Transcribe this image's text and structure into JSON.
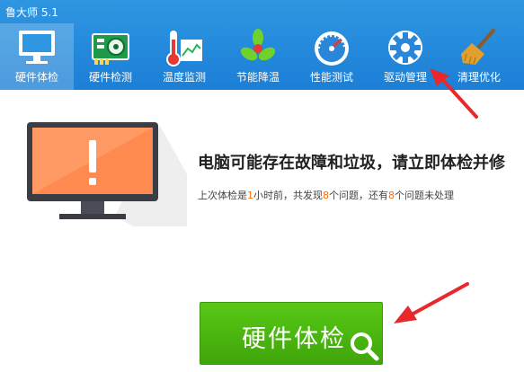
{
  "app": {
    "title": "鲁大师 5.1"
  },
  "nav": {
    "items": [
      {
        "label": "硬件体检",
        "icon": "monitor-icon",
        "active": true
      },
      {
        "label": "硬件检测",
        "icon": "graphics-card-icon",
        "active": false
      },
      {
        "label": "温度监测",
        "icon": "thermometer-icon",
        "active": false
      },
      {
        "label": "节能降温",
        "icon": "fan-icon",
        "active": false
      },
      {
        "label": "性能测试",
        "icon": "speedometer-icon",
        "active": false
      },
      {
        "label": "驱动管理",
        "icon": "gear-icon",
        "active": false
      },
      {
        "label": "清理优化",
        "icon": "broom-icon",
        "active": false
      }
    ]
  },
  "main": {
    "headline": "电脑可能存在故障和垃圾，请立即体检并修",
    "status": {
      "part1": "上次体检是",
      "hours": "1",
      "part2": "小时前，共发现",
      "found": "8",
      "part3": "个问题，还有",
      "remaining": "8",
      "part4": "个问题未处理"
    },
    "check_button": {
      "label": "硬件体检",
      "icon": "search-icon"
    }
  },
  "colors": {
    "topbar": "#1b7fd6",
    "accent_green": "#4bb80f",
    "highlight_number": "#ff6a00",
    "annotation_arrow": "#e8282b"
  }
}
